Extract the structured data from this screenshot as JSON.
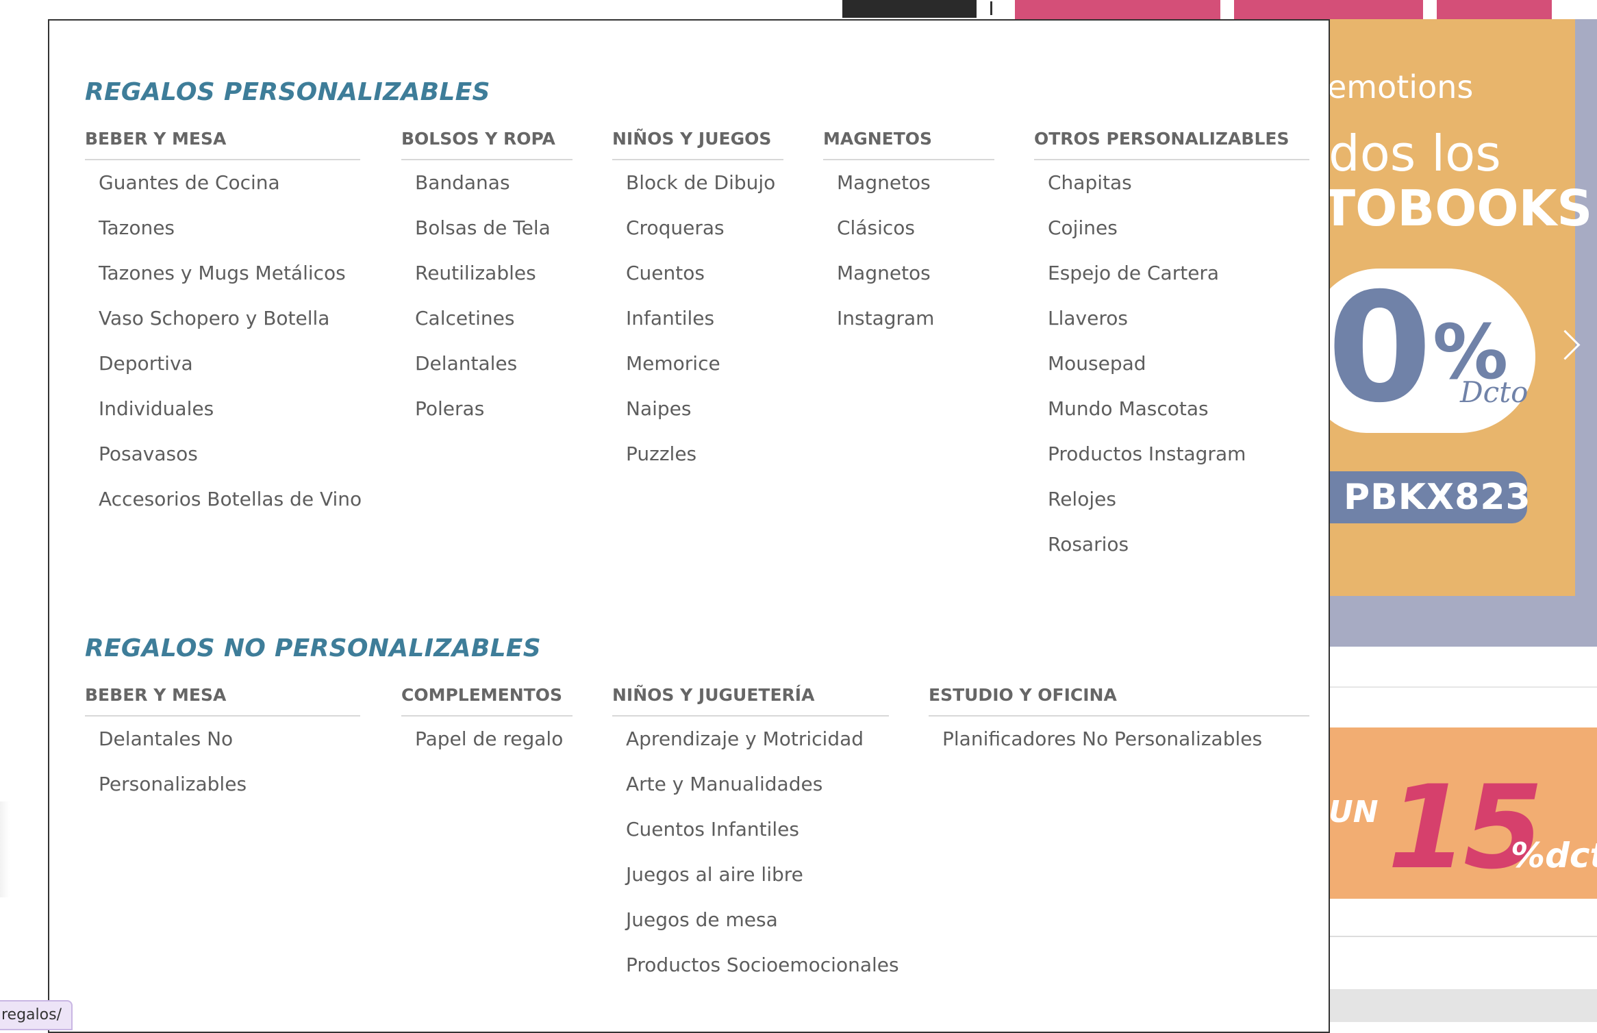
{
  "background_page": {
    "banner_top": {
      "text_line1": "emotions",
      "text_line2": "dos los",
      "text_line3": "TOBOOKS",
      "discount_big": "0",
      "discount_pct": "%",
      "discount_word": "Dcto",
      "promo_code": "PBKX823",
      "next_icon": "chevron-right-icon"
    },
    "banner_bottom": {
      "prefix": "UN",
      "number": "15",
      "suffix": "%dcto"
    }
  },
  "menu": {
    "personalizables": {
      "title": "REGALOS PERSONALIZABLES",
      "columns": [
        {
          "heading": "BEBER Y MESA",
          "items": [
            "Guantes de Cocina",
            "Tazones",
            "Tazones y Mugs Metálicos",
            "Vaso Schopero y Botella",
            "Deportiva",
            "Individuales",
            "Posavasos",
            "Accesorios Botellas de Vino"
          ]
        },
        {
          "heading": "BOLSOS Y ROPA",
          "items": [
            "Bandanas",
            "Bolsas de Tela",
            "Reutilizables",
            "Calcetines",
            "Delantales",
            "Poleras"
          ]
        },
        {
          "heading": "NIÑOS Y JUEGOS",
          "items": [
            "Block de Dibujo",
            "Croqueras",
            "Cuentos",
            "Infantiles",
            "Memorice",
            "Naipes",
            "Puzzles"
          ]
        },
        {
          "heading": "MAGNETOS",
          "items": [
            "Magnetos",
            "Clásicos",
            "Magnetos",
            "Instagram"
          ]
        },
        {
          "heading": "OTROS PERSONALIZABLES",
          "items": [
            "Chapitas",
            "Cojines",
            "Espejo de Cartera",
            "Llaveros",
            "Mousepad",
            "Mundo Mascotas",
            "Productos Instagram",
            "Relojes",
            "Rosarios"
          ]
        }
      ]
    },
    "no_personalizables": {
      "title": "REGALOS NO PERSONALIZABLES",
      "columns": [
        {
          "heading": "BEBER Y MESA",
          "items": [
            "Delantales No",
            "Personalizables"
          ]
        },
        {
          "heading": "COMPLEMENTOS",
          "items": [
            "Papel de regalo"
          ]
        },
        {
          "heading": "NIÑOS Y JUGUETERÍA",
          "items": [
            "Aprendizaje y Motricidad",
            "Arte y Manualidades",
            "Cuentos Infantiles",
            "Juegos al aire libre",
            "Juegos de mesa",
            "Productos Socioemocionales"
          ]
        },
        {
          "heading": "ESTUDIO Y OFICINA",
          "items": [
            "Planificadores No Personalizables"
          ]
        }
      ]
    }
  },
  "status_tooltip": "regalos/"
}
